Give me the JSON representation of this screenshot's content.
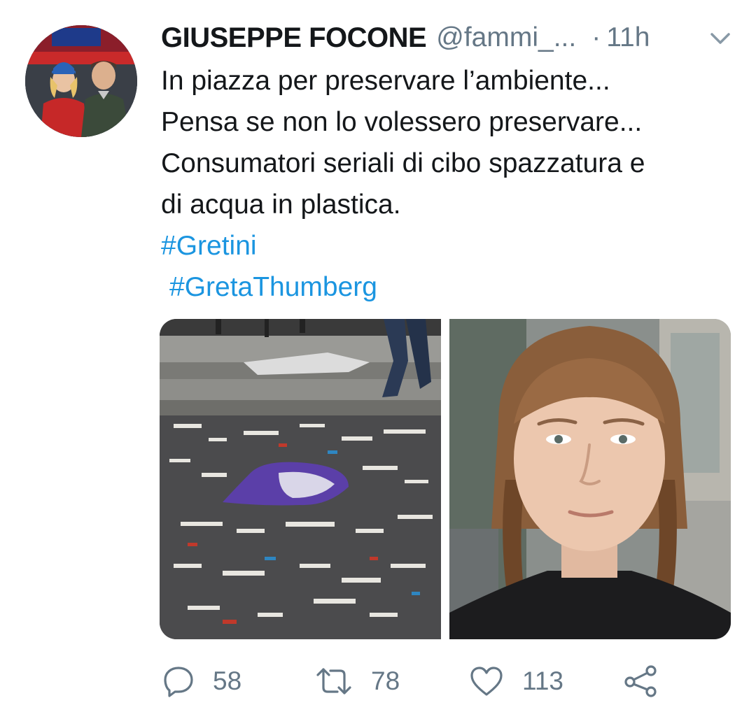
{
  "tweet": {
    "author": {
      "display_name": "GIUSEPPE FOCONE",
      "handle": "@fammi_...",
      "avatar": "avatar-photo"
    },
    "separator": "·",
    "time": "11h",
    "menu_icon": "chevron-down-icon",
    "text_lines": [
      "In piazza per preservare l’ambiente...",
      "Pensa se non lo volessero preservare...",
      "Consumatori seriali di cibo spazzatura e",
      "di acqua in plastica."
    ],
    "hashtags": [
      "#Gretini",
      "#GretaThumberg"
    ],
    "media": [
      {
        "icon": "litter-street-photo"
      },
      {
        "icon": "portrait-photo"
      }
    ],
    "actions": {
      "reply": {
        "icon": "reply-icon",
        "count": "58"
      },
      "retweet": {
        "icon": "retweet-icon",
        "count": "78"
      },
      "like": {
        "icon": "heart-icon",
        "count": "113"
      },
      "share": {
        "icon": "share-icon"
      }
    },
    "colors": {
      "text": "#14171a",
      "secondary": "#657786",
      "link": "#1b95e0"
    }
  }
}
